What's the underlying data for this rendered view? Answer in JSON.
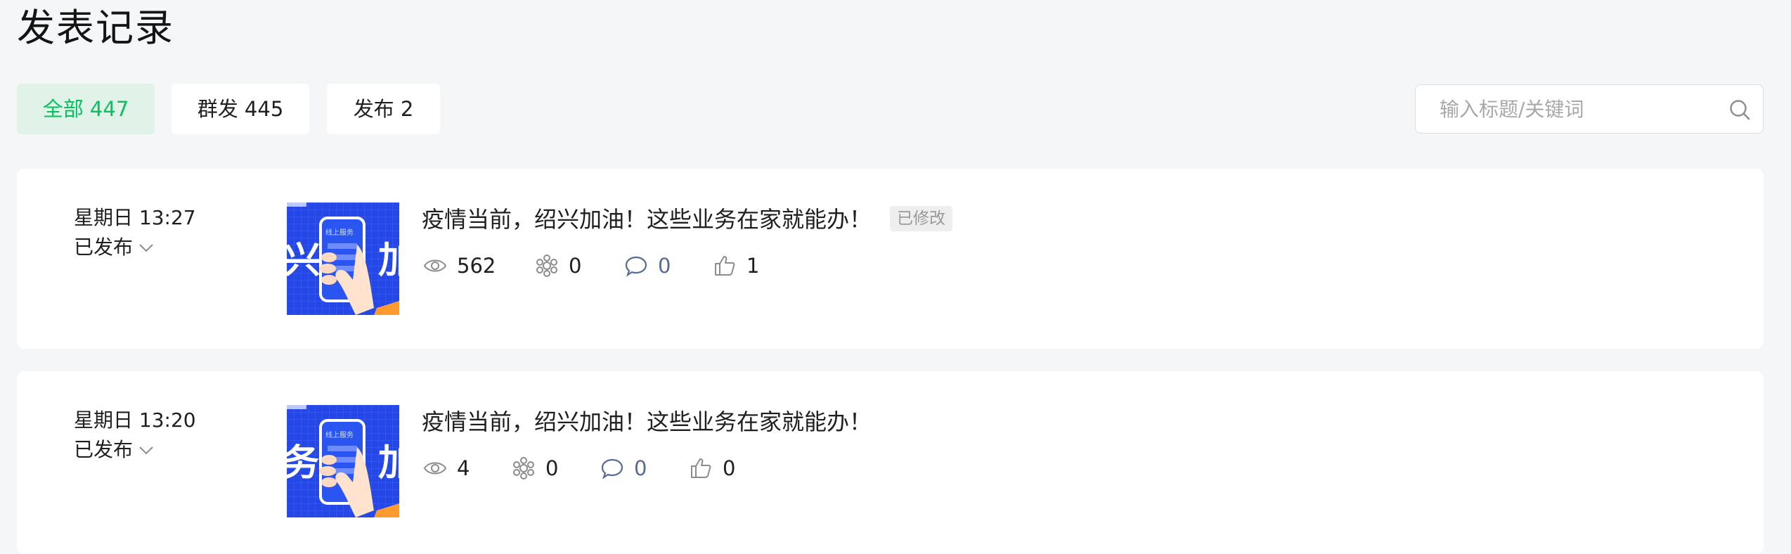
{
  "page": {
    "title": "发表记录"
  },
  "tabs": [
    {
      "label": "全部 447",
      "active": true
    },
    {
      "label": "群发 445",
      "active": false
    },
    {
      "label": "发布 2",
      "active": false
    }
  ],
  "search": {
    "placeholder": "输入标题/关键词",
    "value": ""
  },
  "colors": {
    "accent": "#07c160",
    "accent_bg": "#e1f3e8",
    "link_blue": "#576b95",
    "thumb_blue": "#2447e6"
  },
  "posts": [
    {
      "time": "星期日 13:27",
      "status": "已发布",
      "title": "疫情当前，绍兴加油！这些业务在家就能办！",
      "edited_badge": "已修改",
      "thumbnail_text": "线上服务",
      "stats": {
        "views": "562",
        "shares": "0",
        "comments": "0",
        "likes": "1"
      }
    },
    {
      "time": "星期日 13:20",
      "status": "已发布",
      "title": "疫情当前，绍兴加油！这些业务在家就能办！",
      "thumbnail_text": "线上服务",
      "stats": {
        "views": "4",
        "shares": "0",
        "comments": "0",
        "likes": "0"
      }
    }
  ],
  "icons": {
    "views": "eye-icon",
    "shares": "share-icon",
    "comments": "comment-icon",
    "likes": "thumbs-up-icon",
    "search": "search-icon",
    "status": "chevron-down-icon"
  }
}
